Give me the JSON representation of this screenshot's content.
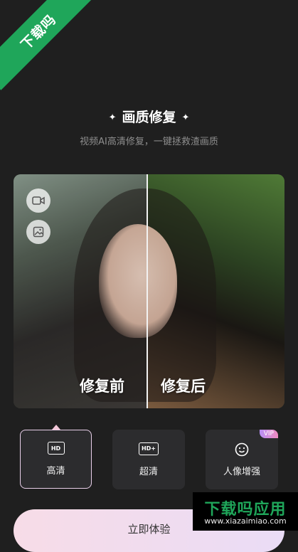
{
  "corner_badge": "下载吗",
  "header": {
    "title": "画质修复",
    "subtitle": "视频AI高清修复，一键拯救渣画质"
  },
  "compare": {
    "before_label": "修复前",
    "after_label": "修复后",
    "side_buttons": [
      "video-icon",
      "image-icon"
    ]
  },
  "options": [
    {
      "icon_text": "HD",
      "label": "高清",
      "selected": true
    },
    {
      "icon_text": "HD+",
      "label": "超清",
      "selected": false
    },
    {
      "icon_text": "",
      "label": "人像增强",
      "selected": false,
      "badge": "VIP"
    }
  ],
  "cta_label": "立即体验",
  "watermark": {
    "title": "下载吗应用",
    "url": "www.xiazaimiao.com"
  },
  "colors": {
    "accent_green": "#1fa65a",
    "selected_border": "#e8cfe9"
  }
}
